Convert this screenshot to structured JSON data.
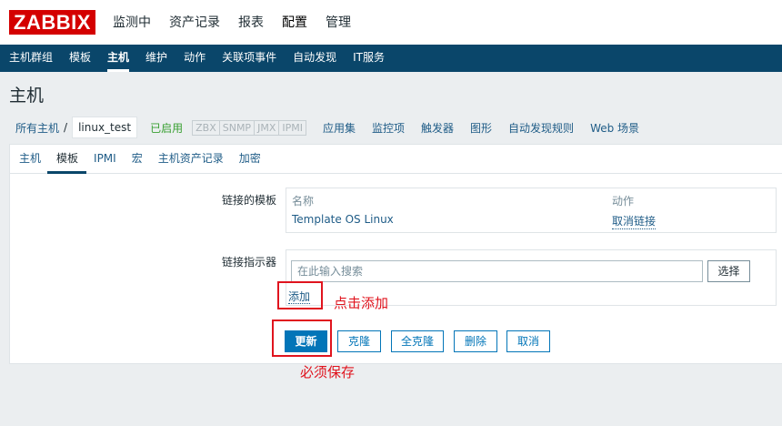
{
  "app": {
    "logo": "ZABBIX"
  },
  "main_menu": [
    {
      "label": "监测中"
    },
    {
      "label": "资产记录"
    },
    {
      "label": "报表"
    },
    {
      "label": "配置"
    },
    {
      "label": "管理"
    }
  ],
  "sub_menu": [
    {
      "label": "主机群组"
    },
    {
      "label": "模板"
    },
    {
      "label": "主机"
    },
    {
      "label": "维护"
    },
    {
      "label": "动作"
    },
    {
      "label": "关联项事件"
    },
    {
      "label": "自动发现"
    },
    {
      "label": "IT服务"
    }
  ],
  "page_title": "主机",
  "host_nav": {
    "all_hosts": "所有主机",
    "separator": "/",
    "current_host": "linux_test",
    "status": "已启用",
    "availability": [
      "ZBX",
      "SNMP",
      "JMX",
      "IPMI"
    ],
    "links": [
      "应用集",
      "监控项",
      "触发器",
      "图形",
      "自动发现规则",
      "Web 场景"
    ]
  },
  "tabs": [
    {
      "label": "主机"
    },
    {
      "label": "模板"
    },
    {
      "label": "IPMI"
    },
    {
      "label": "宏"
    },
    {
      "label": "主机资产记录"
    },
    {
      "label": "加密"
    }
  ],
  "form": {
    "linked_templates_label": "链接的模板",
    "col_name": "名称",
    "col_action": "动作",
    "template_name": "Template OS Linux",
    "unlink_label": "取消链接",
    "link_indicator_label": "链接指示器",
    "search_placeholder": "在此输入搜索",
    "select_label": "选择",
    "add_label": "添加"
  },
  "buttons": {
    "update": "更新",
    "clone": "克隆",
    "full_clone": "全克隆",
    "delete": "删除",
    "cancel": "取消"
  },
  "annotations": {
    "click_add": "点击添加",
    "must_save": "必须保存"
  },
  "colors": {
    "brand_red": "#d40000",
    "nav_blue": "#0a466a",
    "link_blue": "#1f5c87",
    "primary_button": "#0275b8",
    "status_green": "#3aa033",
    "annotation_red": "#e0141e"
  }
}
